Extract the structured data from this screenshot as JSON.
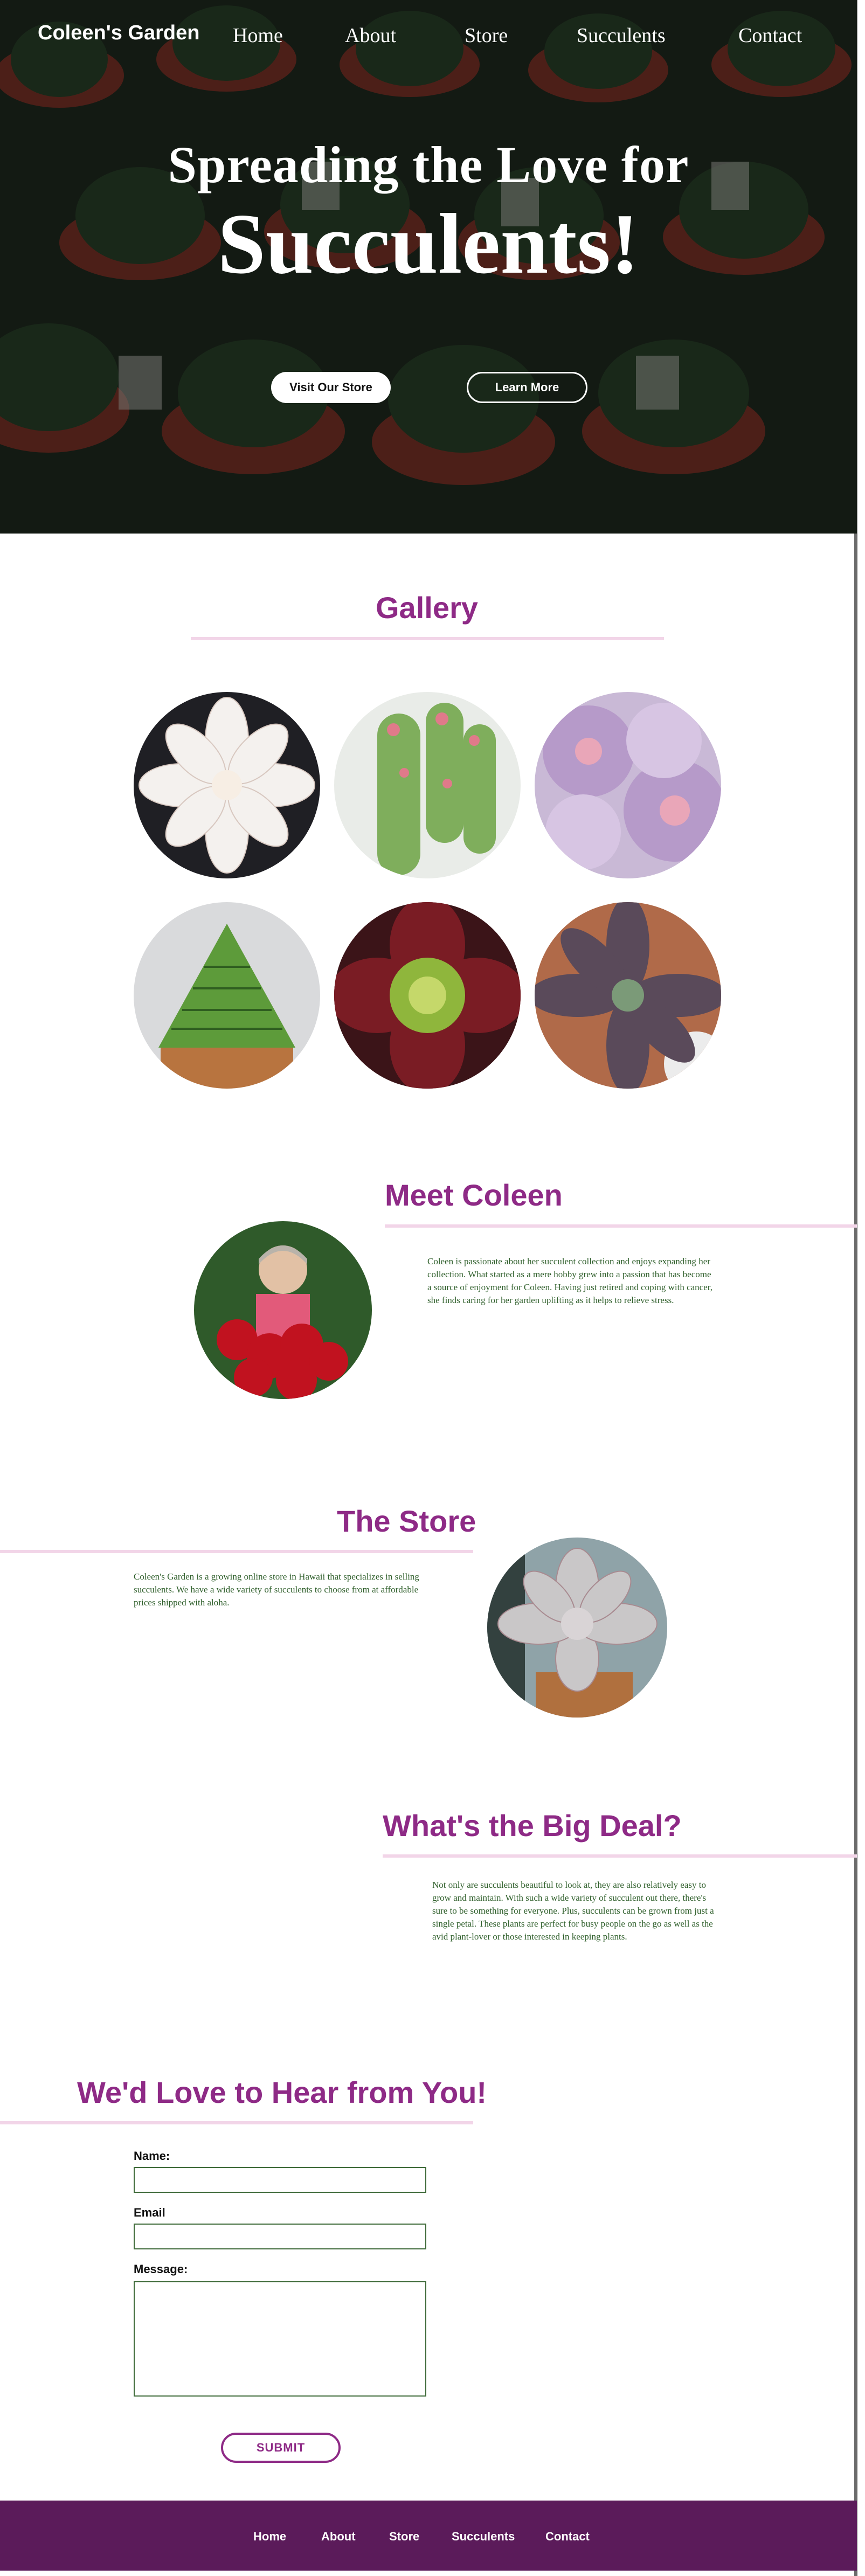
{
  "header": {
    "brand": "Coleen's Garden",
    "nav": [
      "Home",
      "About",
      "Store",
      "Succulents",
      "Contact"
    ]
  },
  "hero": {
    "line1": "Spreading the Love for",
    "line2": "Succulents!",
    "primary_button": "Visit Our Store",
    "secondary_button": "Learn More"
  },
  "gallery": {
    "title": "Gallery"
  },
  "meet": {
    "title": "Meet Coleen",
    "text": "Coleen is passionate about her succulent collection and enjoys expanding her collection. What started as a mere hobby grew into a passion that has become a source of enjoyment for Coleen. Having just retired and coping with cancer, she finds caring for her garden uplifting as it helps to relieve stress."
  },
  "store": {
    "title": "The Store",
    "text": "Coleen's Garden is a growing online store in Hawaii that specializes in selling succulents. We have a wide variety of succulents to choose from at affordable prices shipped with aloha."
  },
  "bigdeal": {
    "title": "What's the Big Deal?",
    "text": "Not only are succulents beautiful to look at, they are also relatively easy to grow and maintain. With such a wide variety of succulent out there, there's sure to be something for everyone. Plus, succulents can be grown from just a single petal. These plants are perfect for busy people on the go as well as the avid plant-lover or those interested in keeping plants."
  },
  "contact": {
    "title": "We'd Love to Hear from You!",
    "name_label": "Name:",
    "email_label": "Email",
    "message_label": "Message:",
    "name_value": "",
    "email_value": "",
    "message_value": "",
    "submit": "SUBMIT"
  },
  "footer": {
    "nav": [
      "Home",
      "About",
      "Store",
      "Succulents",
      "Contact"
    ]
  },
  "colors": {
    "accent": "#8e2a86",
    "rule": "#f2d5e8",
    "footer": "#5b1b5a",
    "body_text": "#2f5f2b"
  }
}
